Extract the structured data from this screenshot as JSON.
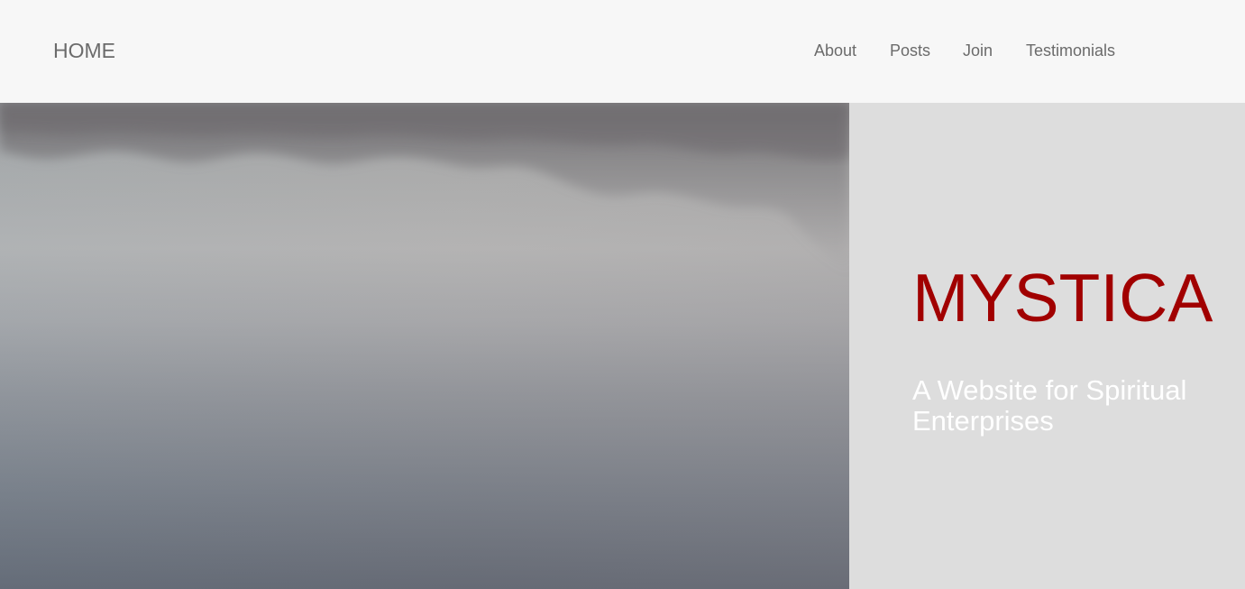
{
  "navbar": {
    "brand": "HOME",
    "links": [
      "About",
      "Posts",
      "Join",
      "Testimonials"
    ]
  },
  "hero": {
    "image_subject": "misty-lake-reflection",
    "title": "MYSTICA",
    "subtitle": "A Website for Spiritual Enterprises"
  },
  "colors": {
    "navbar_bg": "#f7f7f7",
    "nav_text": "#6b6b6b",
    "panel_bg": "#dddddd",
    "title": "#a10000",
    "subtitle": "#ffffff"
  }
}
